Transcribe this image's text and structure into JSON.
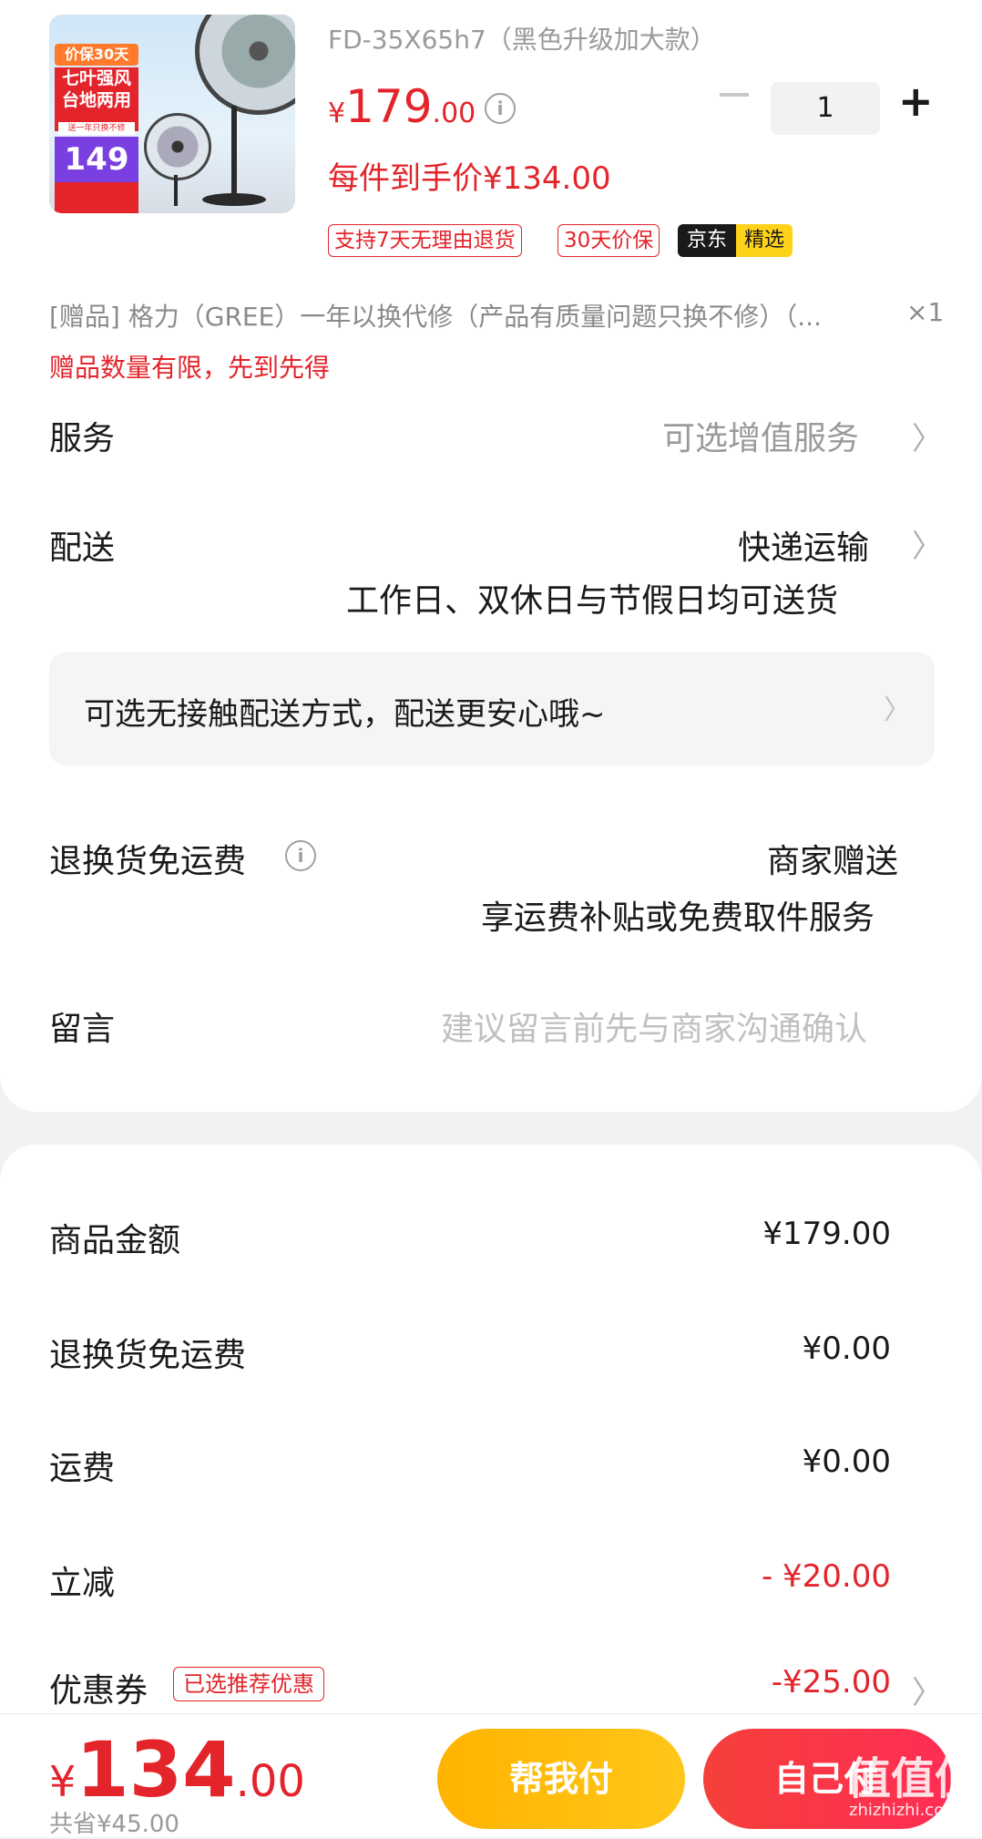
{
  "product": {
    "model": "FD-35X65h7（黑色升级加大款）",
    "thumbnail": {
      "badge": "价保30天",
      "headline": "七叶强风台地两用",
      "sub": "送一年只换不修",
      "promo_price": "149"
    },
    "price_currency": "¥",
    "price_int": "179",
    "price_dec": ".00",
    "quantity": "1",
    "each_price": "每件到手价¥134.00",
    "tags": [
      "支持7天无理由退货",
      "30天价保"
    ],
    "jd_label": "京东",
    "jd_selected": "精选"
  },
  "gift": {
    "text": "[赠品]  格力（GREE）一年以换代修（产品有质量问题只换不修）（...",
    "qty": "×1",
    "note": "赠品数量有限，先到先得"
  },
  "service": {
    "label": "服务",
    "value": "可选增值服务"
  },
  "delivery": {
    "label": "配送",
    "value": "快递运输",
    "detail": "工作日、双休日与节假日均可送货",
    "contactless": "可选无接触配送方式，配送更安心哦~"
  },
  "return_shipping": {
    "label": "退换货免运费",
    "value": "商家赠送",
    "detail": "享运费补贴或免费取件服务"
  },
  "message": {
    "label": "留言",
    "placeholder": "建议留言前先与商家沟通确认"
  },
  "summary": [
    {
      "label": "商品金额",
      "value": "¥179.00"
    },
    {
      "label": "退换货免运费",
      "value": "¥0.00"
    },
    {
      "label": "运费",
      "value": "¥0.00"
    },
    {
      "label": "立减",
      "value": "- ¥20.00"
    },
    {
      "label": "优惠券",
      "value": "-¥25.00",
      "tag": "已选推荐优惠"
    }
  ],
  "bottom": {
    "currency": "¥",
    "total_int": "134",
    "total_dec": ".00",
    "saved": "共省¥45.00",
    "help_pay": "帮我付",
    "self_pay": "自己付"
  },
  "watermark": {
    "text": "值值值",
    "url": "zhizhizhi.com"
  },
  "colors": {
    "accent": "#e3242b",
    "help_btn": "#ffb300",
    "pay_btn": "#f5403a"
  }
}
